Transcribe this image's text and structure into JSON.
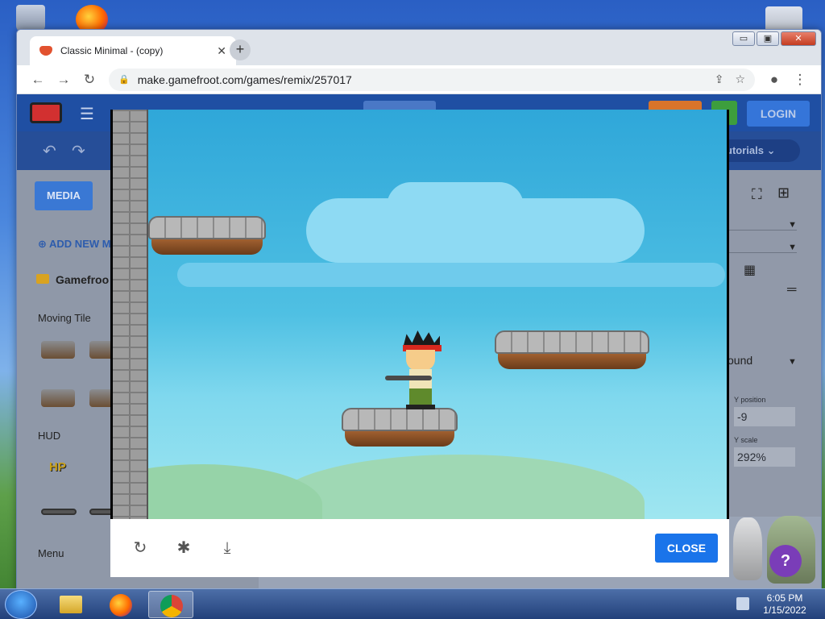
{
  "browser": {
    "tab_title": "Classic Minimal - (copy)",
    "tab_close": "✕",
    "new_tab": "+",
    "url": "make.gamefroot.com/games/remix/257017",
    "win_min": "▭",
    "win_max": "▣",
    "win_close": "✕"
  },
  "editor": {
    "login_label": "LOGIN",
    "tutorials_label": "utorials ⌄",
    "media_label": "MEDIA",
    "add_new_label": "ADD NEW M",
    "folder_label": "Gamefroo",
    "moving_tile_label": "Moving Tile",
    "hud_label": "HUD",
    "hp_label": "HP",
    "menu_label": "Menu",
    "background_label": "ound",
    "y_position_label": "Y position",
    "y_position_value": "-9",
    "y_scale_label": "Y scale",
    "y_scale_value": "292%"
  },
  "modal": {
    "close_label": "CLOSE"
  },
  "taskbar": {
    "time": "6:05 PM",
    "date": "1/15/2022"
  },
  "colors": {
    "close_button": "#1a74ea",
    "sky": "#3fb4e0",
    "editor_header": "#1f4fa3"
  }
}
